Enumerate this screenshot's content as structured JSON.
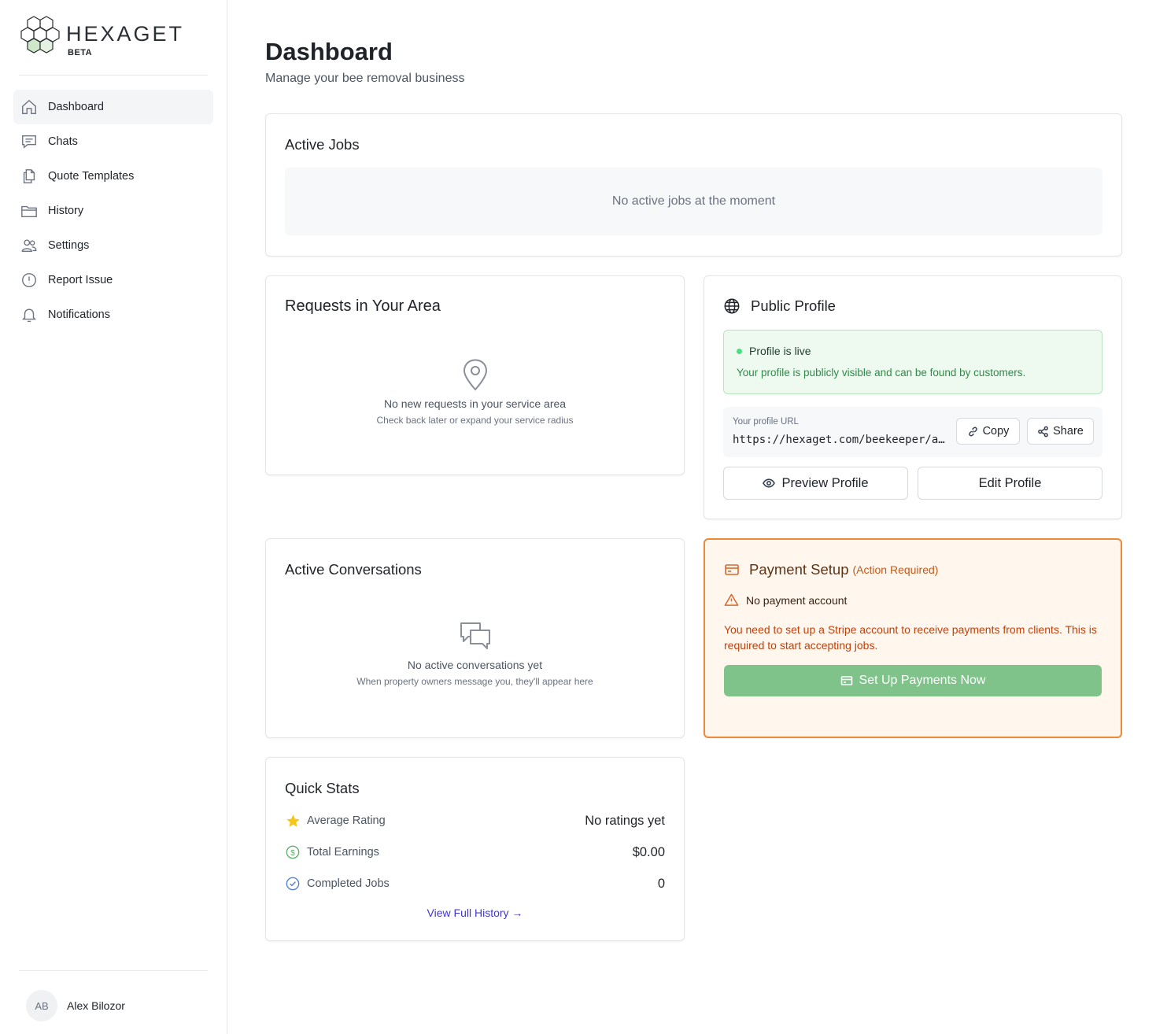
{
  "brand": {
    "name": "HEXAGET",
    "badge": "BETA"
  },
  "sidebar": {
    "items": [
      {
        "label": "Dashboard",
        "icon": "home-icon",
        "active": true
      },
      {
        "label": "Chats",
        "icon": "chat-icon"
      },
      {
        "label": "Quote Templates",
        "icon": "documents-icon"
      },
      {
        "label": "History",
        "icon": "folder-icon"
      },
      {
        "label": "Settings",
        "icon": "users-icon"
      },
      {
        "label": "Report Issue",
        "icon": "alert-circle-icon"
      },
      {
        "label": "Notifications",
        "icon": "bell-icon"
      }
    ],
    "user": {
      "initials": "AB",
      "name": "Alex Bilozor"
    }
  },
  "header": {
    "title": "Dashboard",
    "subtitle": "Manage your bee removal business"
  },
  "active_jobs": {
    "title": "Active Jobs",
    "empty": "No active jobs at the moment"
  },
  "requests": {
    "title": "Requests in Your Area",
    "empty": "No new requests in your service area",
    "hint": "Check back later or expand your service radius"
  },
  "public_profile": {
    "title": "Public Profile",
    "status_title": "Profile is live",
    "status_text": "Your profile is publicly visible and can be found by customers.",
    "url_label": "Your profile URL",
    "url_value": "https://hexaget.com/beekeeper/alex-bilozor",
    "copy_label": "Copy",
    "share_label": "Share",
    "preview_label": "Preview Profile",
    "edit_label": "Edit Profile"
  },
  "conversations": {
    "title": "Active Conversations",
    "empty": "No active conversations yet",
    "hint": "When property owners message you, they'll appear here"
  },
  "payment": {
    "title": "Payment Setup",
    "required": "(Action Required)",
    "warning": "No payment account",
    "description": "You need to set up a Stripe account to receive payments from clients. This is required to start accepting jobs.",
    "button": "Set Up Payments Now"
  },
  "quick_stats": {
    "title": "Quick Stats",
    "rows": [
      {
        "label": "Average Rating",
        "value": "No ratings yet",
        "icon": "star-icon"
      },
      {
        "label": "Total Earnings",
        "value": "$0.00",
        "icon": "dollar-circle-icon"
      },
      {
        "label": "Completed Jobs",
        "value": "0",
        "icon": "check-circle-icon"
      }
    ],
    "link": "View Full History →"
  },
  "colors": {
    "accent_orange": "#ec8a3c",
    "success_green": "#7fc28a",
    "link_indigo": "#4338ca",
    "star_yellow": "#f5c518"
  }
}
